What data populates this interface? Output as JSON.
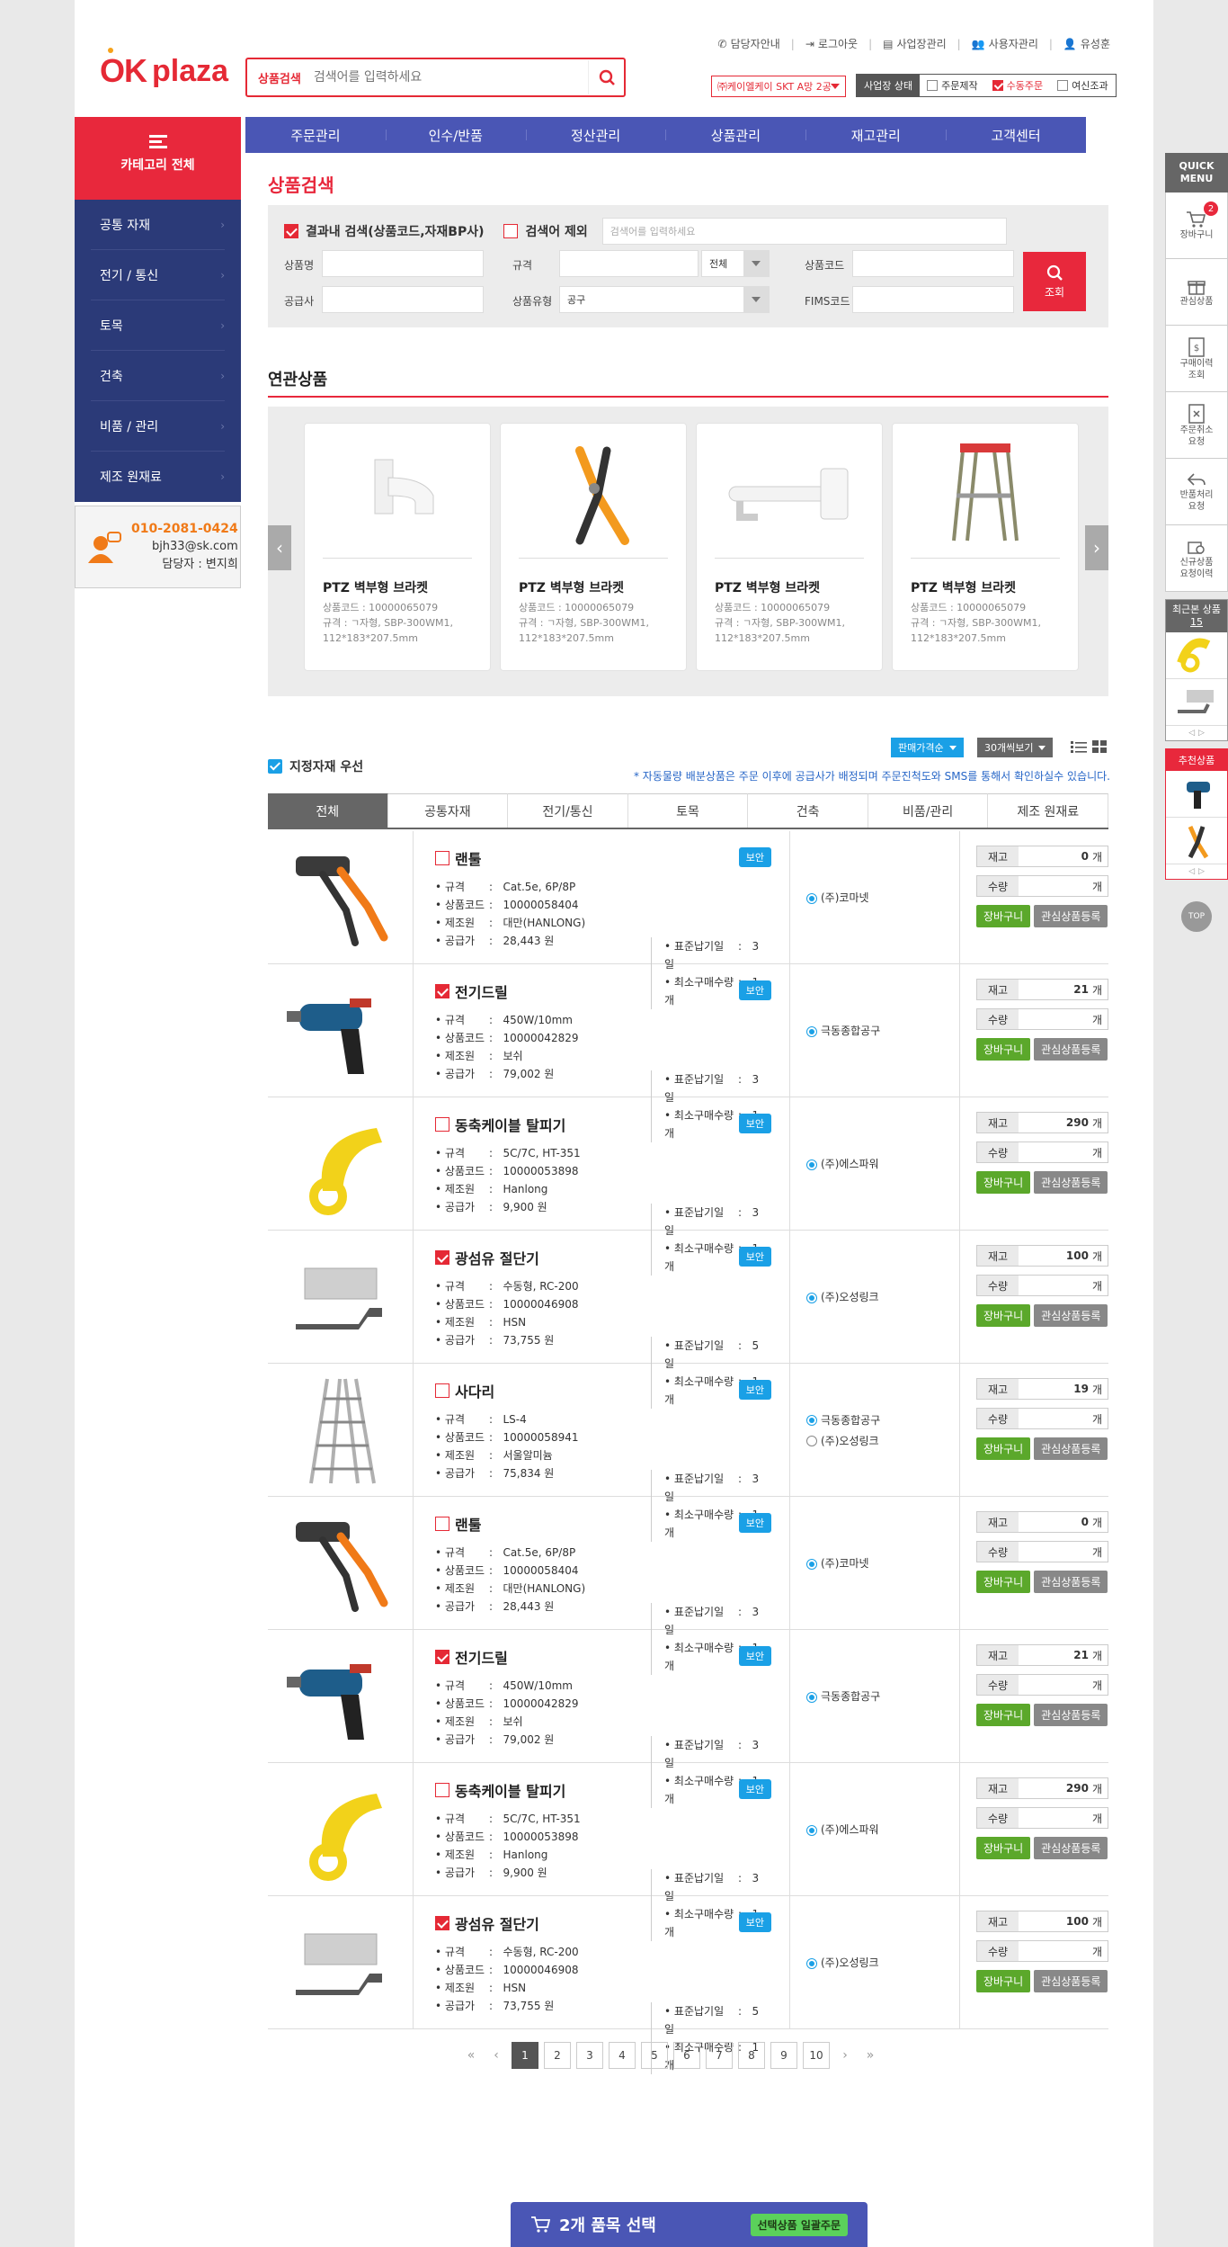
{
  "header": {
    "util": [
      "담당자안내",
      "로그아웃",
      "사업장관리",
      "사용자관리",
      "유성훈"
    ],
    "logo_ok": "OK",
    "logo_plaza": "plaza",
    "search_label": "상품검색",
    "search_placeholder": "검색어를 입력하세요",
    "site_select": "㈜케이엘케이 SKT A망 2공",
    "biz_status_label": "사업장 상태",
    "biz_status_opts": [
      "주문제작",
      "수동주문",
      "여신조과"
    ]
  },
  "sidebar": {
    "title": "카테고리 전체",
    "items": [
      "공통 자재",
      "전기 / 통신",
      "토목",
      "건축",
      "비품 / 관리",
      "제조 원재료"
    ],
    "contact_phone": "010-2081-0424",
    "contact_email": "bjh33@sk.com",
    "contact_name": "담당자 : 변지희"
  },
  "gnb": [
    "주문관리",
    "인수/반품",
    "정산관리",
    "상품관리",
    "재고관리",
    "고객센터"
  ],
  "search": {
    "title": "상품검색",
    "in_result": "결과내 검색(상품코드,자재BP사)",
    "exclude": "검색어 제외",
    "keyword_placeholder": "검색어를 입력하세요",
    "fields": {
      "name": "상품명",
      "spec": "규격",
      "spec_select": "전체",
      "code": "상품코드",
      "supplier": "공급사",
      "type": "상품유형",
      "type_value": "공구",
      "fims": "FIMS코드"
    },
    "button": "조회"
  },
  "related": {
    "title": "연관상품",
    "cards": [
      {
        "name": "PTZ 벽부형 브라켓",
        "code": "상품코드 : 10000065079",
        "spec": "규격 : ㄱ자형, SBP-300WM1,",
        "size": "112*183*207.5mm"
      },
      {
        "name": "PTZ 벽부형 브라켓",
        "code": "상품코드 : 10000065079",
        "spec": "규격 : ㄱ자형, SBP-300WM1,",
        "size": "112*183*207.5mm"
      },
      {
        "name": "PTZ 벽부형 브라켓",
        "code": "상품코드 : 10000065079",
        "spec": "규격 : ㄱ자형, SBP-300WM1,",
        "size": "112*183*207.5mm"
      },
      {
        "name": "PTZ 벽부형 브라켓",
        "code": "상품코드 : 10000065079",
        "spec": "규격 : ㄱ자형, SBP-300WM1,",
        "size": "112*183*207.5mm"
      }
    ]
  },
  "list": {
    "priority": "지정자재 우선",
    "sort": "판매가격순",
    "per_page": "30개씩보기",
    "notice": "* 자동물량 배분상품은 주문 이후에 공급사가 배정되며 주문진척도와 SMS를 통해서 확인하실수 있습니다.",
    "tabs": [
      "전체",
      "공통자재",
      "전기/통신",
      "토목",
      "건축",
      "비품/관리",
      "제조 원재료"
    ],
    "labels": {
      "spec": "규격",
      "code": "상품코드",
      "maker": "제조원",
      "price": "공급가",
      "lead": "표준납기일",
      "minq": "최소구매수량",
      "stock": "재고",
      "qty": "수량",
      "unit": "개",
      "cart": "장바구니",
      "wish": "관심상품등록",
      "badge": "보안"
    },
    "products": [
      {
        "name": "랜툴",
        "checked": false,
        "spec": "Cat.5e, 6P/8P",
        "code": "10000058404",
        "maker": "대만(HANLONG)",
        "price": "28,443 원",
        "lead": "3 일",
        "minq": "1 개",
        "suppliers": [
          "(주)코마넷"
        ],
        "stock": "0",
        "img": "crimper"
      },
      {
        "name": "전기드릴",
        "checked": true,
        "spec": "450W/10mm",
        "code": "10000042829",
        "maker": "보쉬",
        "price": "79,002 원",
        "lead": "3 일",
        "minq": "1 개",
        "suppliers": [
          "극동종합공구"
        ],
        "stock": "21",
        "img": "drill"
      },
      {
        "name": "동축케이블 탈피기",
        "checked": false,
        "spec": "5C/7C, HT-351",
        "code": "10000053898",
        "maker": "Hanlong",
        "price": "9,900 원",
        "lead": "3 일",
        "minq": "1 개",
        "suppliers": [
          "(주)에스파워"
        ],
        "stock": "290",
        "img": "stripper"
      },
      {
        "name": "광섬유 절단기",
        "checked": true,
        "spec": "수동형, RC-200",
        "code": "10000046908",
        "maker": "HSN",
        "price": "73,755 원",
        "lead": "5 일",
        "minq": "1 개",
        "suppliers": [
          "(주)오성링크"
        ],
        "stock": "100",
        "img": "cleaver"
      },
      {
        "name": "사다리",
        "checked": false,
        "spec": "LS-4",
        "code": "10000058941",
        "maker": "서울알미늄",
        "price": "75,834 원",
        "lead": "3 일",
        "minq": "1 개",
        "suppliers": [
          "극동종합공구",
          "(주)오성링크"
        ],
        "stock": "19",
        "img": "ladder"
      },
      {
        "name": "랜툴",
        "checked": false,
        "spec": "Cat.5e, 6P/8P",
        "code": "10000058404",
        "maker": "대만(HANLONG)",
        "price": "28,443 원",
        "lead": "3 일",
        "minq": "1 개",
        "suppliers": [
          "(주)코마넷"
        ],
        "stock": "0",
        "img": "crimper"
      },
      {
        "name": "전기드릴",
        "checked": true,
        "spec": "450W/10mm",
        "code": "10000042829",
        "maker": "보쉬",
        "price": "79,002 원",
        "lead": "3 일",
        "minq": "1 개",
        "suppliers": [
          "극동종합공구"
        ],
        "stock": "21",
        "img": "drill"
      },
      {
        "name": "동축케이블 탈피기",
        "checked": false,
        "spec": "5C/7C, HT-351",
        "code": "10000053898",
        "maker": "Hanlong",
        "price": "9,900 원",
        "lead": "3 일",
        "minq": "1 개",
        "suppliers": [
          "(주)에스파워"
        ],
        "stock": "290",
        "img": "stripper"
      },
      {
        "name": "광섬유 절단기",
        "checked": true,
        "spec": "수동형, RC-200",
        "code": "10000046908",
        "maker": "HSN",
        "price": "73,755 원",
        "lead": "5 일",
        "minq": "1 개",
        "suppliers": [
          "(주)오성링크"
        ],
        "stock": "100",
        "img": "cleaver"
      }
    ]
  },
  "pager": {
    "pages": [
      "1",
      "2",
      "3",
      "4",
      "5",
      "6",
      "7",
      "8",
      "9",
      "10"
    ],
    "current": "1"
  },
  "bottom_bar": {
    "text": "2개 품목 선택",
    "action": "선택상품 일괄주문"
  },
  "quick": {
    "title": "QUICK MENU",
    "items": [
      {
        "label": "장바구니",
        "count": "2"
      },
      {
        "label": "관심상품"
      },
      {
        "label": "구매이력 조회"
      },
      {
        "label": "주문취소 요청"
      },
      {
        "label": "반품처리 요청"
      },
      {
        "label": "신규상품 요청이력"
      }
    ],
    "recent_title": "최근본 상품",
    "recent_count": "15",
    "reco_title": "추천상품",
    "top": "TOP"
  },
  "colors": {
    "accent": "#e8283c",
    "nav": "#4a56b5",
    "sidebar": "#2b3a78",
    "badge": "#1aa0e6",
    "cart_btn": "#5ba82b"
  }
}
